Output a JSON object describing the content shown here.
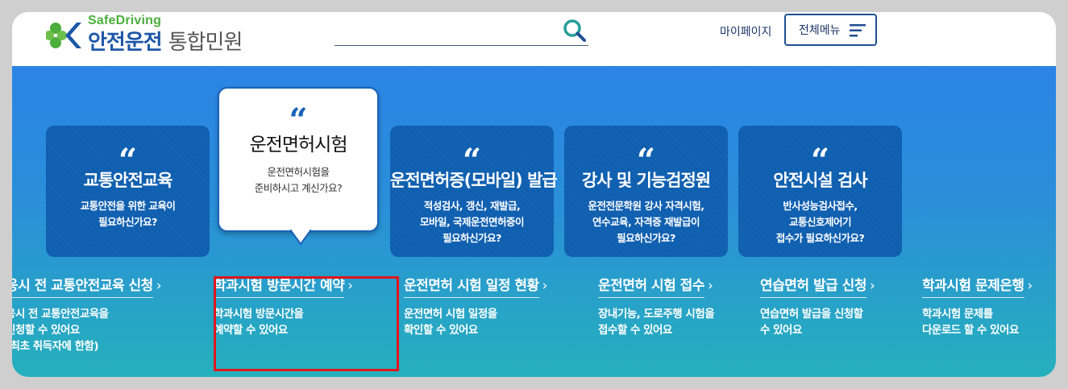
{
  "header": {
    "logo_en": "SafeDriving",
    "logo_ko_main": "안전운전",
    "logo_ko_sub": "통합민원",
    "search_placeholder": "",
    "mypage_label": "마이페이지",
    "menu_label": "전체메뉴"
  },
  "colors": {
    "brand_blue": "#1f57a8",
    "brand_green": "#4cae3c",
    "card_bg": "#0f5fb0",
    "highlight_red": "#e0161c"
  },
  "cards": [
    {
      "title": "교통안전교육",
      "desc": "교통안전을 위한 교육이\n필요하신가요?"
    },
    {
      "title": "운전면허시험",
      "desc": "운전면허시험을\n준비하시고 계신가요?",
      "active": true
    },
    {
      "title": "운전면허증(모바일) 발급",
      "desc": "적성검사, 갱신, 재발급,\n모바일, 국제운전면허증이\n필요하신가요?"
    },
    {
      "title": "강사 및 기능검정원",
      "desc": "운전전문학원 강사 자격시험,\n연수교육, 자격증 재발급이\n필요하신가요?"
    },
    {
      "title": "안전시설 검사",
      "desc": "반사성능검사접수,\n교통신호제어기\n접수가 필요하신가요?"
    }
  ],
  "quote_glyph": "“",
  "links": [
    {
      "title": "응시 전 교통안전교육 신청",
      "desc": "응시 전 교통안전교육을\n신청할 수 있어요\n(최초 취득자에 한함)"
    },
    {
      "title": "학과시험 방문시간 예약",
      "desc": "학과시험 방문시간을\n예약할 수 있어요"
    },
    {
      "title": "운전면허 시험 일정 현황",
      "desc": "운전면허 시험 일정을\n확인할 수 있어요"
    },
    {
      "title": "운전면허 시험 접수",
      "desc": "장내기능, 도로주행 시험을\n접수할 수 있어요"
    },
    {
      "title": "연습면허 발급 신청",
      "desc": "연습면허 발급을 신청할\n수 있어요"
    },
    {
      "title": "학과시험 문제은행",
      "desc": "학과시험 문제를\n다운로드 할 수 있어요"
    }
  ],
  "link_arrow": "›"
}
